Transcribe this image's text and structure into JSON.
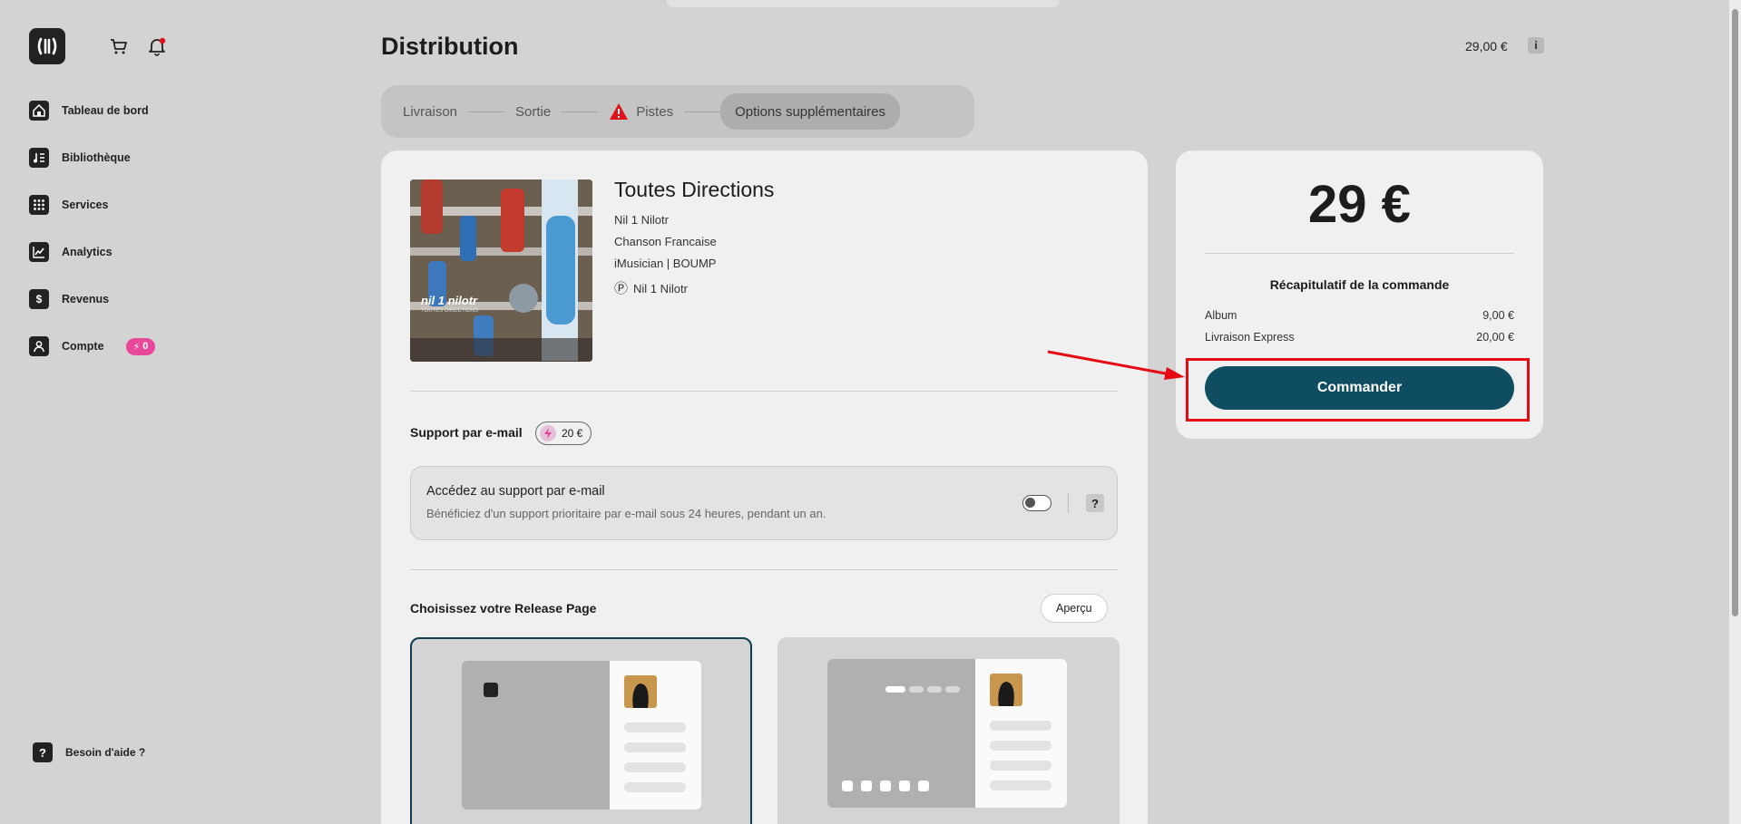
{
  "header": {
    "title": "Distribution",
    "total_price": "29,00 €",
    "info_label": "i"
  },
  "sidebar": {
    "items": [
      {
        "label": "Tableau de bord",
        "icon": "home-icon"
      },
      {
        "label": "Bibliothèque",
        "icon": "music-library-icon"
      },
      {
        "label": "Services",
        "icon": "grid-icon"
      },
      {
        "label": "Analytics",
        "icon": "chart-icon"
      },
      {
        "label": "Revenus",
        "icon": "dollar-icon"
      },
      {
        "label": "Compte",
        "icon": "user-icon"
      }
    ],
    "credits_badge": "0",
    "help_label": "Besoin d'aide ?",
    "help_icon_text": "?"
  },
  "stepper": {
    "steps": [
      "Livraison",
      "Sortie",
      "Pistes",
      "Options supplémentaires"
    ],
    "active_step": "Options supplémentaires",
    "warning_step": "Pistes"
  },
  "release": {
    "title": "Toutes Directions",
    "artist": "Nil 1 Nilotr",
    "genre": "Chanson Francaise",
    "label": "iMusician | BOUMP",
    "p_line_symbol": "Ⓟ",
    "p_line": "Nil 1 Nilotr",
    "cover_text": "nil 1 nilotr",
    "cover_subtext": "TOUTES DIRECTIONS"
  },
  "support": {
    "section_title": "Support par e-mail",
    "price": "20 €",
    "option_title": "Accédez au support par e-mail",
    "option_desc": "Bénéficiez d'un support prioritaire par e-mail sous 24 heures, pendant un an.",
    "enabled": false,
    "help_label": "?"
  },
  "release_page": {
    "section_title": "Choisissez votre Release Page",
    "preview_button": "Aperçu",
    "selected_template": 0
  },
  "summary": {
    "price": "29 €",
    "title": "Récapitulatif de la commande",
    "rows": [
      {
        "label": "Album",
        "value": "9,00 €"
      },
      {
        "label": "Livraison Express",
        "value": "20,00 €"
      }
    ],
    "order_button": "Commander"
  },
  "colors": {
    "accent": "#0f4e62",
    "badge": "#e9479a",
    "annotation": "#e50914",
    "warning": "#e2121a"
  }
}
